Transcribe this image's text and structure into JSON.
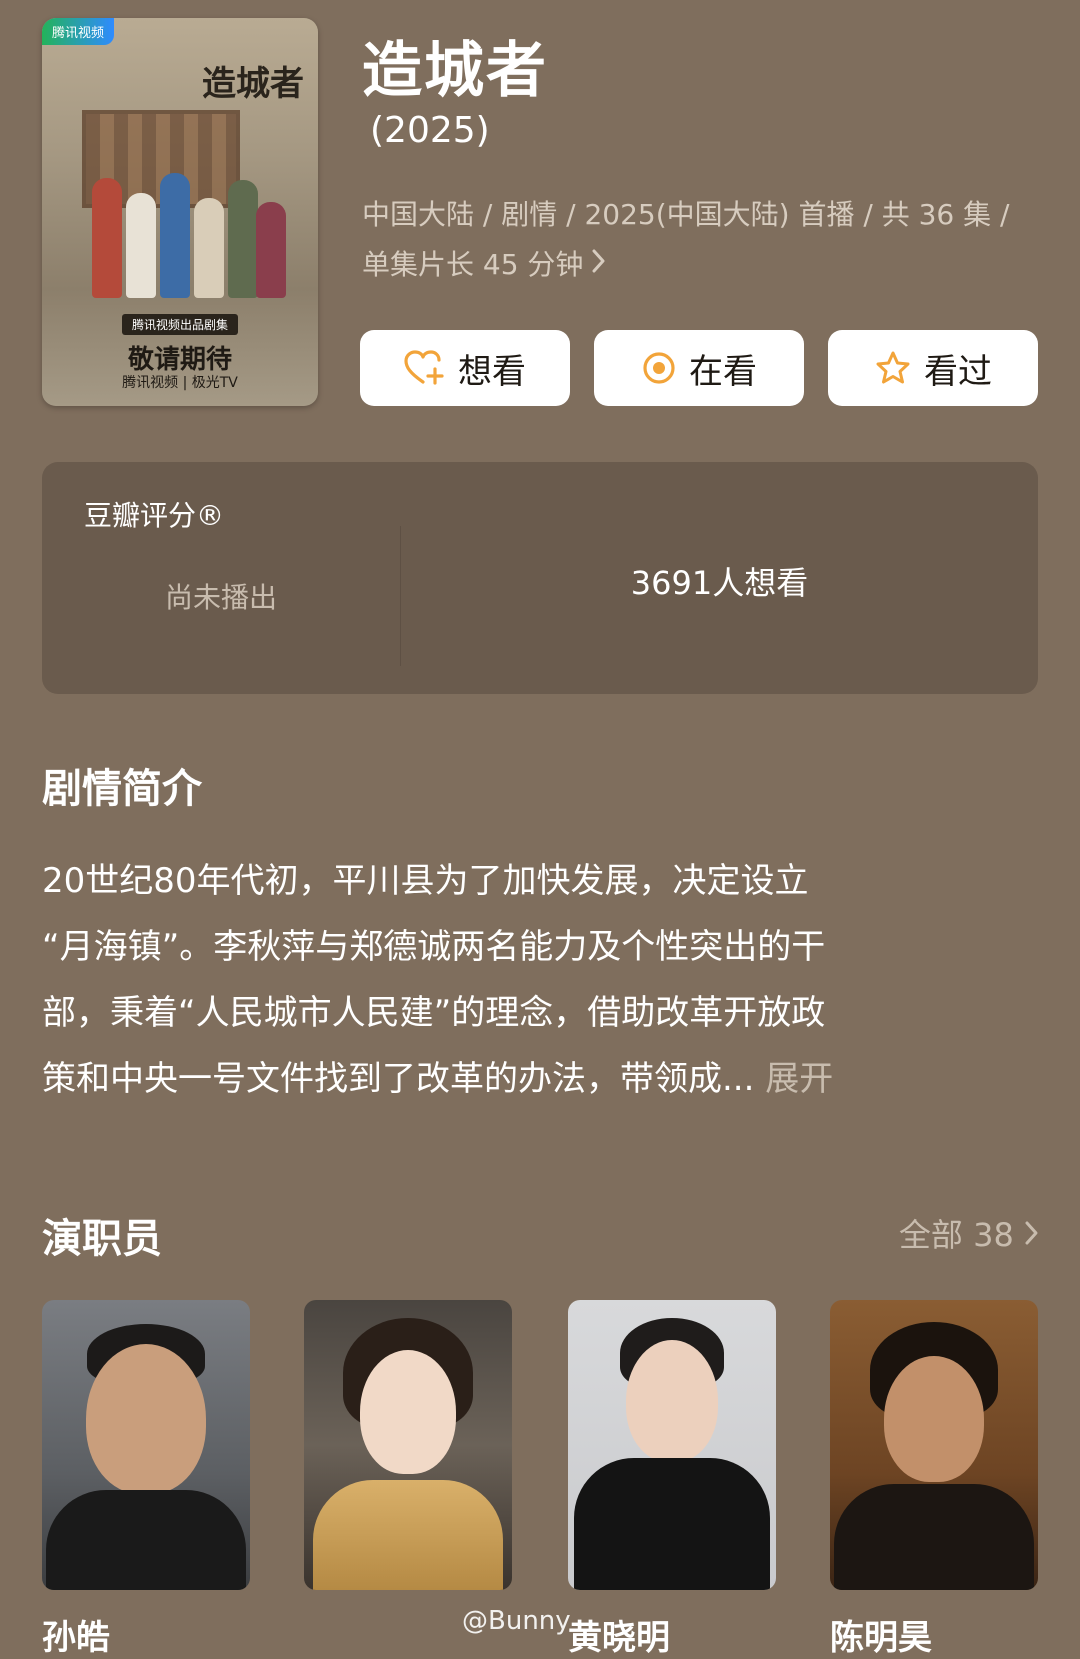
{
  "poster": {
    "badge": "腾讯视频",
    "title": "造城者",
    "tag_small": "腾讯视频出品剧集",
    "tag_big": "敬请期待",
    "logos": "腾讯视频 | 极光TV"
  },
  "show": {
    "title": "造城者",
    "year": "(2025)",
    "meta_line1": "中国大陆 / 剧情 / 2025(中国大陆) 首播 / 共 36 集 /",
    "meta_line2": "单集片长 45 分钟"
  },
  "actions": {
    "want": "想看",
    "watching": "在看",
    "watched": "看过"
  },
  "rating": {
    "label": "豆瓣评分®",
    "status": "尚未播出",
    "want_count": "3691人想看"
  },
  "synopsis": {
    "title": "剧情简介",
    "lines": [
      "20世纪80年代初，平川县为了加快发展，决定设立",
      "“月海镇”。李秋萍与郑德诚两名能力及个性突出的干",
      "部，秉着“人民城市人民建”的理念，借助改革开放政",
      "策和中央一号文件找到了改革的办法，带领成..."
    ],
    "expand": "展开"
  },
  "cast": {
    "title": "演职员",
    "all": "全部 38",
    "members": [
      {
        "name": "孙皓"
      },
      {
        "name": ""
      },
      {
        "name": "黄晓明"
      },
      {
        "name": "陈明昊"
      }
    ]
  },
  "watermark": "@Bunny",
  "colors": {
    "background": "#7f6e5d",
    "card": "#6a5b4d",
    "accent": "#f2a43a",
    "muted_text": "#c8bcae"
  },
  "icons": {
    "want": "heart-plus-icon",
    "watching": "target-circle-icon",
    "watched": "star-icon",
    "chevron": "chevron-right-icon"
  }
}
